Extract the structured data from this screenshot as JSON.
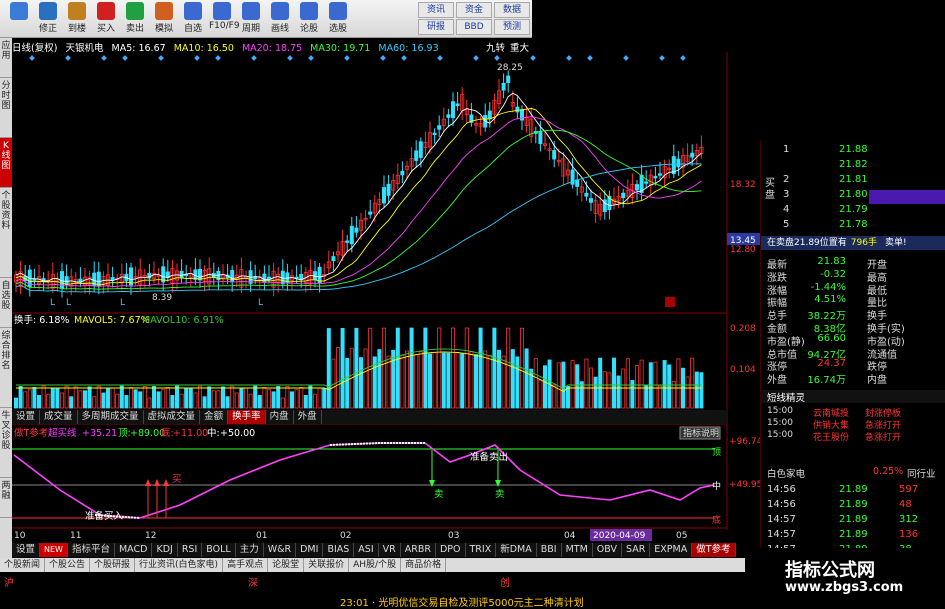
{
  "toolbar": {
    "buttons": [
      {
        "label": "",
        "icon": "home-icon",
        "color": "#3a7bd5"
      },
      {
        "label": "修正",
        "icon": "eye-icon",
        "color": "#2a70c0"
      },
      {
        "label": "到楼",
        "icon": "clock-icon",
        "color": "#c08020"
      },
      {
        "label": "买入",
        "icon": "buy-icon",
        "color": "#d02020"
      },
      {
        "label": "卖出",
        "icon": "sell-icon",
        "color": "#20a040"
      },
      {
        "label": "模拟",
        "icon": "hammer-icon",
        "color": "#d06020"
      },
      {
        "label": "自选",
        "icon": "star-icon",
        "color": "#3a6ad0"
      },
      {
        "label": "F10/F9",
        "icon": "f10-icon",
        "color": "#3a6ad0"
      },
      {
        "label": "周期",
        "icon": "cycle-icon",
        "color": "#3a6ad0"
      },
      {
        "label": "画线",
        "icon": "pen-icon",
        "color": "#3a6ad0"
      },
      {
        "label": "论股",
        "icon": "forum-icon",
        "color": "#3a6ad0"
      },
      {
        "label": "选股",
        "icon": "select-icon",
        "color": "#3a6ad0"
      }
    ],
    "right": [
      "资讯",
      "资金",
      "研报",
      "BBD",
      "数据",
      "预测"
    ]
  },
  "left_tabs": [
    "应用",
    "分时图",
    "K线图",
    "个股资料",
    "自选股",
    "综合排名",
    "牛叉诊股",
    "两融"
  ],
  "header": {
    "mode": "日线(复权)",
    "stock": "天银机电",
    "ma5": "MA5: 16.67",
    "ma10": "MA10: 16.50",
    "ma20": "MA20: 18.75",
    "ma30": "MA30: 19.71",
    "ma60": "MA60: 16.93",
    "tag1": "九转",
    "tag2": "重大"
  },
  "kline": {
    "high_label": "28.25",
    "low_label": "8.39",
    "price_ticks": [
      "18.32",
      "13.45",
      "12.80"
    ],
    "marks": [
      "L",
      "L",
      "L",
      "L"
    ]
  },
  "volume": {
    "header_a": "换手: 6.18%",
    "header_b": "MAVOL5: 7.67%",
    "header_c": "MAVOL10: 6.91%",
    "ticks": [
      "0.208",
      "0.104"
    ]
  },
  "tabs1": [
    "设置",
    "成交量",
    "多周期成交量",
    "虚拟成交量",
    "金额",
    "换手率",
    "内盘",
    "外盘"
  ],
  "indicator": {
    "title": "做T参考",
    "line": "超买线",
    "v1": "+35.21",
    "v1_label": "顶:",
    "v2": "+89.00",
    "v2_label": "底:",
    "v3": "+11.00",
    "v4_label": "中:",
    "v4": "+50.00",
    "help": "指标说明",
    "ticks": [
      "+96.74",
      "+49.95"
    ],
    "sell_text": "准备卖出",
    "buy_text": "准备买入",
    "sell_marks": [
      "卖",
      "卖"
    ],
    "buy_mark": "买",
    "right_labels": [
      "顶",
      "中",
      "底"
    ]
  },
  "xaxis": {
    "labels": [
      "10",
      "11",
      "12",
      "01",
      "02",
      "03",
      "04",
      "05"
    ],
    "date_badge": "2020-04-09"
  },
  "tabs2": [
    "设置",
    "NEW",
    "指标平台",
    "MACD",
    "KDJ",
    "RSI",
    "BOLL",
    "主力",
    "W&R",
    "DMI",
    "BIAS",
    "ASI",
    "VR",
    "ARBR",
    "DPO",
    "TRIX",
    "新DMA",
    "BBI",
    "MTM",
    "OBV",
    "SAR",
    "EXPMA",
    "做T参考"
  ],
  "bottom_tabs": [
    "个股新闻",
    "个股公告",
    "个股研报",
    "行业资讯(白色家电)",
    "高手观点",
    "论股堂",
    "关联报价",
    "AH股/个股",
    "商品价格"
  ],
  "status": {
    "row1_a": "沪",
    "row1_b": "深",
    "row1_c": "创",
    "ticker": "23:01 · 光明优信交易自检及测评5000元主二种清计划"
  },
  "order_book": [
    {
      "n": "1",
      "price": "21.88",
      "vol": ""
    },
    {
      "n": "",
      "price": "21.82",
      "vol": ""
    },
    {
      "n": "2",
      "price": "21.81",
      "vol": ""
    },
    {
      "n": "3",
      "price": "21.80",
      "vol": ""
    },
    {
      "n": "4",
      "price": "21.79",
      "vol": ""
    },
    {
      "n": "5",
      "price": "21.78",
      "vol": ""
    }
  ],
  "ob_side_label": "买盘",
  "quote_bar": {
    "a": "在卖盘21.89位置有",
    "b": "796手",
    "c": "卖单!"
  },
  "stats": [
    {
      "k1": "最新",
      "v1": "21.83",
      "k2": "开盘",
      "v2": ""
    },
    {
      "k1": "涨跌",
      "v1": "-0.32",
      "k2": "最高",
      "v2": ""
    },
    {
      "k1": "涨幅",
      "v1": "-1.44%",
      "k2": "最低",
      "v2": ""
    },
    {
      "k1": "振幅",
      "v1": "4.51%",
      "k2": "量比",
      "v2": ""
    },
    {
      "k1": "总手",
      "v1": "38.22万",
      "k2": "换手",
      "v2": ""
    },
    {
      "k1": "金额",
      "v1": "8.38亿",
      "k2": "换手(实)",
      "v2": ""
    },
    {
      "k1": "市盈(静)",
      "v1": "66.60",
      "k2": "市盈(动)",
      "v2": ""
    },
    {
      "k1": "总市值",
      "v1": "94.27亿",
      "k2": "流通值",
      "v2": ""
    },
    {
      "k1": "涨停",
      "v1": "24.37",
      "k2": "跌停",
      "v2": ""
    },
    {
      "k1": "外盘",
      "v1": "16.74万",
      "k2": "内盘",
      "v2": ""
    }
  ],
  "sprite": {
    "title": "短线精灵",
    "rows": [
      {
        "t": "15:00",
        "s": "云南城投",
        "a": "封涨停板"
      },
      {
        "t": "15:00",
        "s": "供销大集",
        "a": "急涨打开"
      },
      {
        "t": "15:00",
        "s": "花王股份",
        "a": "急涨打开"
      }
    ]
  },
  "industry": {
    "name": "白色家电",
    "pct": "0.25%",
    "btn": "同行业"
  },
  "ticks_list": [
    {
      "t": "14:56",
      "p": "21.89",
      "v": "597"
    },
    {
      "t": "14:56",
      "p": "21.89",
      "v": "48"
    },
    {
      "t": "14:57",
      "p": "21.89",
      "v": "312"
    },
    {
      "t": "14:57",
      "p": "21.89",
      "v": "136"
    },
    {
      "t": "14:57",
      "p": "21.89",
      "v": "38"
    }
  ],
  "watermark": {
    "title": "指标公式网",
    "url": "www.zbgs3.com"
  },
  "colors": {
    "up": "#ff3030",
    "down": "#30e0ff",
    "green": "#33ff33",
    "magenta": "#ff40ff",
    "yellow": "#ffff00"
  }
}
